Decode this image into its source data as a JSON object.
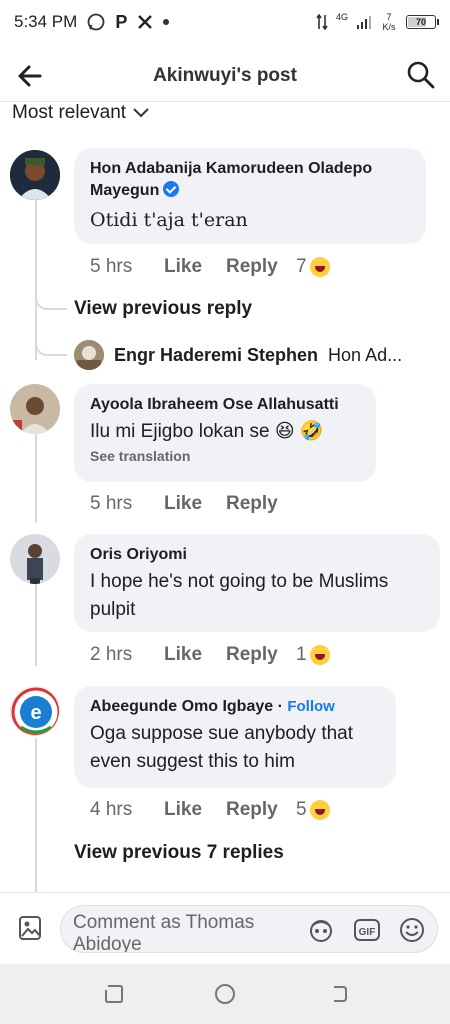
{
  "status_bar": {
    "time": "5:34 PM",
    "left_icons": [
      "whatsapp-icon",
      "p-icon",
      "x-icon",
      "dot-icon"
    ],
    "network": "4G",
    "speed": "7 K/s",
    "battery": "70",
    "battery_level": 0.7
  },
  "header": {
    "title": "Akinwuyi's post",
    "back_icon": "back-arrow-icon",
    "search_icon": "search-icon"
  },
  "sort": {
    "label": "Most relevant"
  },
  "comments": [
    {
      "name": "Hon Adabanija Kamorudeen Oladepo Mayegun",
      "verified": true,
      "text": "Otidi t'aja t'eran",
      "time": "5 hrs",
      "like": "Like",
      "reply": "Reply",
      "reactions": "7"
    },
    {
      "name": "Ayoola Ibraheem Ose Allahusatti",
      "text": "Ilu mi Ejigbo lokan se 😆 🤣",
      "see_translation": "See translation",
      "time": "5 hrs",
      "like": "Like",
      "reply": "Reply"
    },
    {
      "name": "Oris Oriyomi",
      "text": "I hope he's not going to be Muslims pulpit",
      "time": "2 hrs",
      "like": "Like",
      "reply": "Reply",
      "reactions": "1"
    },
    {
      "name": "Abeegunde Omo Igbaye",
      "follow": "Follow",
      "text": "Oga suppose sue anybody that even suggest this to him",
      "time": "4 hrs",
      "like": "Like",
      "reply": "Reply",
      "reactions": "5"
    }
  ],
  "thread1": {
    "view_previous": "View previous reply",
    "reply_name": "Engr Haderemi Stephen",
    "reply_preview": "Hon Ad..."
  },
  "thread4": {
    "view_previous": "View previous 7 replies"
  },
  "composer": {
    "placeholder": "Comment as Thomas Abidoye"
  }
}
